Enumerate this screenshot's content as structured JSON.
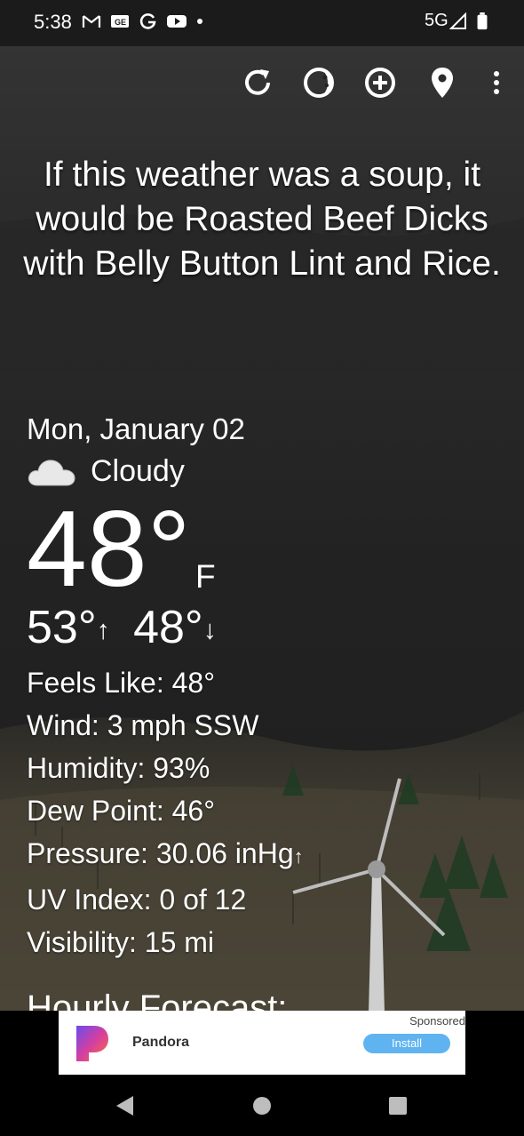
{
  "status_bar": {
    "time": "5:38",
    "left_icons": [
      "gmail-icon",
      "news-icon",
      "google-icon",
      "youtube-icon",
      "dot-icon"
    ],
    "network": "5G",
    "right_icons": [
      "signal-icon",
      "battery-icon"
    ]
  },
  "toolbar": {
    "icons": [
      "refresh-icon",
      "theme-icon",
      "add-location-icon",
      "location-pin-icon",
      "more-options-icon"
    ]
  },
  "quip": "If this weather was a soup, it would be Roasted Beef Dicks with Belly Button Lint and Rice.",
  "weather": {
    "date": "Mon, January 02",
    "condition": "Cloudy",
    "temperature": "48°",
    "unit": "F",
    "high": "53°",
    "low": "48°",
    "high_arrow": "↑",
    "low_arrow": "↓"
  },
  "details": {
    "feels_like": "Feels Like:  48°",
    "wind": "Wind:  3 mph SSW",
    "humidity": "Humidity:  93%",
    "dew_point": "Dew Point:  46°",
    "pressure": "Pressure:  30.06 inHg",
    "pressure_arrow": "↑",
    "uv_index": "UV Index:  0 of 12",
    "visibility": "Visibility:  15 mi"
  },
  "section_title": "Hourly Forecast:",
  "ad": {
    "sponsored": "Sponsored",
    "app_name": "Pandora",
    "install_label": "Install",
    "logo": "pandora-logo"
  },
  "nav": {
    "icons": [
      "back-icon",
      "home-icon",
      "recents-icon"
    ]
  },
  "colors": {
    "background": "#222222",
    "ground": "#4a4538",
    "ad_button": "#5fb3f0"
  }
}
